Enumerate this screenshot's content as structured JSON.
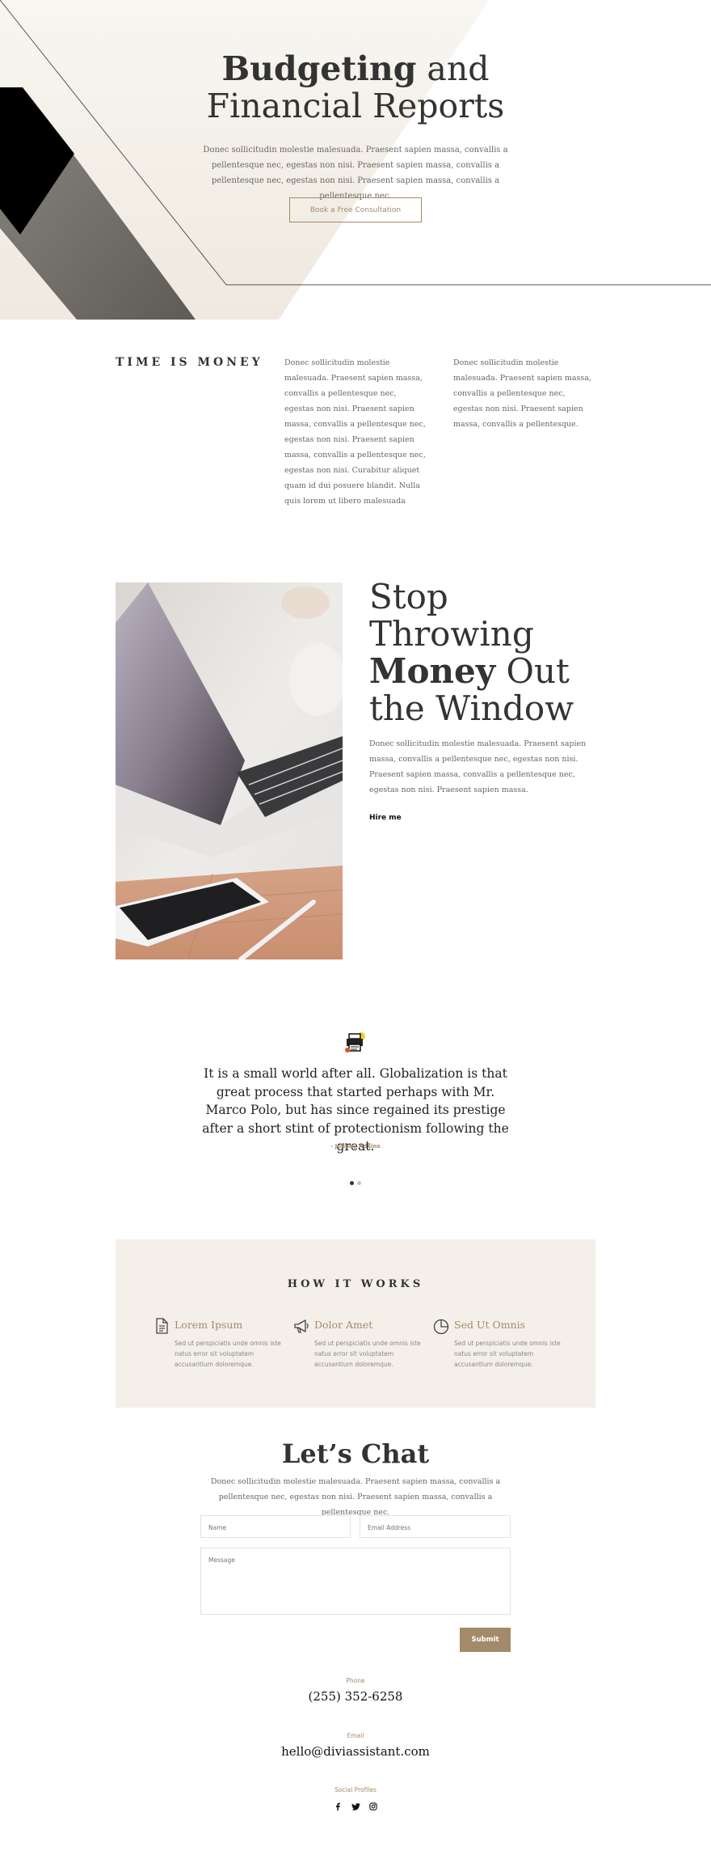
{
  "hero": {
    "title_bold": "Budgeting",
    "title_rest": " and",
    "title_line2": "Financial Reports",
    "text": "Donec sollicitudin molestie malesuada. Praesent sapien massa, convallis a pellentesque nec, egestas non nisi. Praesent sapien massa, convallis a pellentesque nec, egestas non nisi. Praesent sapien massa, convallis a pellentesque nec.",
    "button": "Book a Free Consultation"
  },
  "time_is_money": {
    "heading": "TIME IS MONEY",
    "col1": "Donec sollicitudin molestie malesuada. Praesent sapien massa, convallis a pellentesque nec, egestas non nisi. Praesent sapien massa, convallis a pellentesque nec, egestas non nisi. Praesent sapien massa, convallis a pellentesque nec, egestas non nisi. Curabitur aliquet quam id dui posuere blandit. Nulla quis lorem ut libero malesuada",
    "col2": "Donec sollicitudin molestie malesuada. Praesent sapien massa, convallis a pellentesque nec, egestas non nisi. Praesent sapien massa, convallis a pellentesque."
  },
  "stop": {
    "line1": "Stop",
    "line2": "Throwing",
    "line3_bold": "Money",
    "line3_rest": " Out",
    "line4": "the Window",
    "text": "Donec sollicitudin molestie malesuada. Praesent sapien massa, convallis a pellentesque nec, egestas non nisi. Praesent sapien massa, convallis a pellentesque nec, egestas non nisi. Praesent sapien massa.",
    "link": "Hire me"
  },
  "testimonial": {
    "quote": "It is a small world after all. Globalization is that great process that started perhaps with Mr. Marco Polo, but has since regained its prestige after a short stint of protectionism following the great.",
    "author": "- Johnny Adkins",
    "active_slide": 1,
    "slide_count": 2
  },
  "how_it_works": {
    "title": "HOW IT WORKS",
    "items": [
      {
        "title": "Lorem Ipsum",
        "desc": "Sed ut perspiciatis unde omnis iste natus error sit voluptatem accusantium doloremque.",
        "icon": "document-icon"
      },
      {
        "title": "Dolor Amet",
        "desc": "Sed ut perspiciatis unde omnis iste natus error sit voluptatem accusantium doloremque.",
        "icon": "megaphone-icon"
      },
      {
        "title": "Sed Ut Omnis",
        "desc": "Sed ut perspiciatis unde omnis iste natus error sit voluptatem accusantium doloremque.",
        "icon": "pie-chart-icon"
      }
    ]
  },
  "chat": {
    "title": "Let’s Chat",
    "text": "Donec sollicitudin molestie malesuada. Praesent sapien massa, convallis a pellentesque nec, egestas non nisi. Praesent sapien massa, convallis a pellentesque nec.",
    "name_placeholder": "Name",
    "email_placeholder": "Email Address",
    "message_placeholder": "Message",
    "submit": "Submit"
  },
  "contact": {
    "phone_label": "Phone",
    "phone": "(255) 352-6258",
    "email_label": "Email",
    "email": "hello@diviassistant.com",
    "social_label": "Social Profiles",
    "social": [
      "facebook-icon",
      "twitter-icon",
      "instagram-icon"
    ]
  },
  "colors": {
    "accent": "#a38a6a",
    "beige": "#f4f0e9",
    "text": "#333333"
  }
}
